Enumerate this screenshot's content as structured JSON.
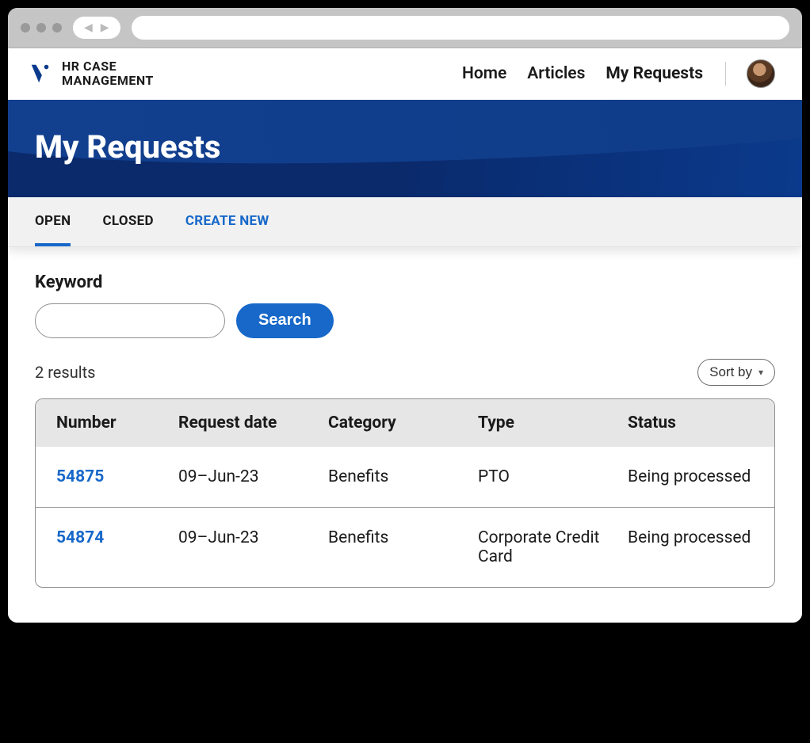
{
  "brand": {
    "line1": "HR CASE",
    "line2": "MANAGEMENT"
  },
  "nav": {
    "home": "Home",
    "articles": "Articles",
    "myRequests": "My Requests"
  },
  "hero": {
    "title": "My Requests"
  },
  "tabs": {
    "open": "OPEN",
    "closed": "CLOSED",
    "createNew": "CREATE NEW"
  },
  "search": {
    "label": "Keyword",
    "button": "Search",
    "value": ""
  },
  "results": {
    "count": "2 results",
    "sortBy": "Sort by"
  },
  "table": {
    "headers": {
      "number": "Number",
      "requestDate": "Request date",
      "category": "Category",
      "type": "Type",
      "status": "Status"
    },
    "rows": [
      {
        "number": "54875",
        "requestDate": "09–Jun-23",
        "category": "Benefits",
        "type": "PTO",
        "status": "Being processed"
      },
      {
        "number": "54874",
        "requestDate": "09–Jun-23",
        "category": "Benefits",
        "type": "Corporate Credit Card",
        "status": "Being processed"
      }
    ]
  }
}
